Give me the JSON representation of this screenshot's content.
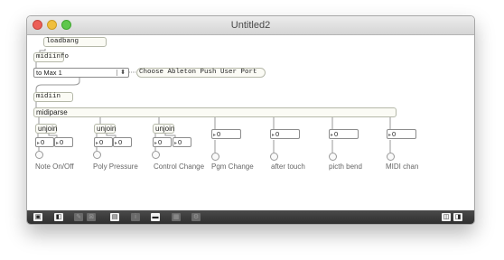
{
  "window": {
    "title": "Untitled2"
  },
  "objects": {
    "loadbang": "loadbang",
    "midiinfo": "midiinfo",
    "midiin": "midiin",
    "midiparse": "midiparse",
    "unjoin": "unjoin"
  },
  "port_menu": {
    "selected": "to Max 1"
  },
  "comment": "Choose Ableton Push User Port",
  "number_box": {
    "value": "0",
    "arrow": "▸"
  },
  "outputs": [
    {
      "label": "Note On/Off"
    },
    {
      "label": "Poly Pressure"
    },
    {
      "label": "Control Change"
    },
    {
      "label": "Pgm Change"
    },
    {
      "label": "after touch"
    },
    {
      "label": "picth bend"
    },
    {
      "label": "MIDI chan"
    }
  ],
  "toolbar": {
    "icons": [
      "lock-icon",
      "presentation-icon",
      "edit-icon",
      "grid-icon",
      "inspector-icon",
      "info-icon",
      "patcher-icon",
      "table-icon",
      "debug-icon",
      "split-left-icon",
      "split-right-icon"
    ]
  }
}
